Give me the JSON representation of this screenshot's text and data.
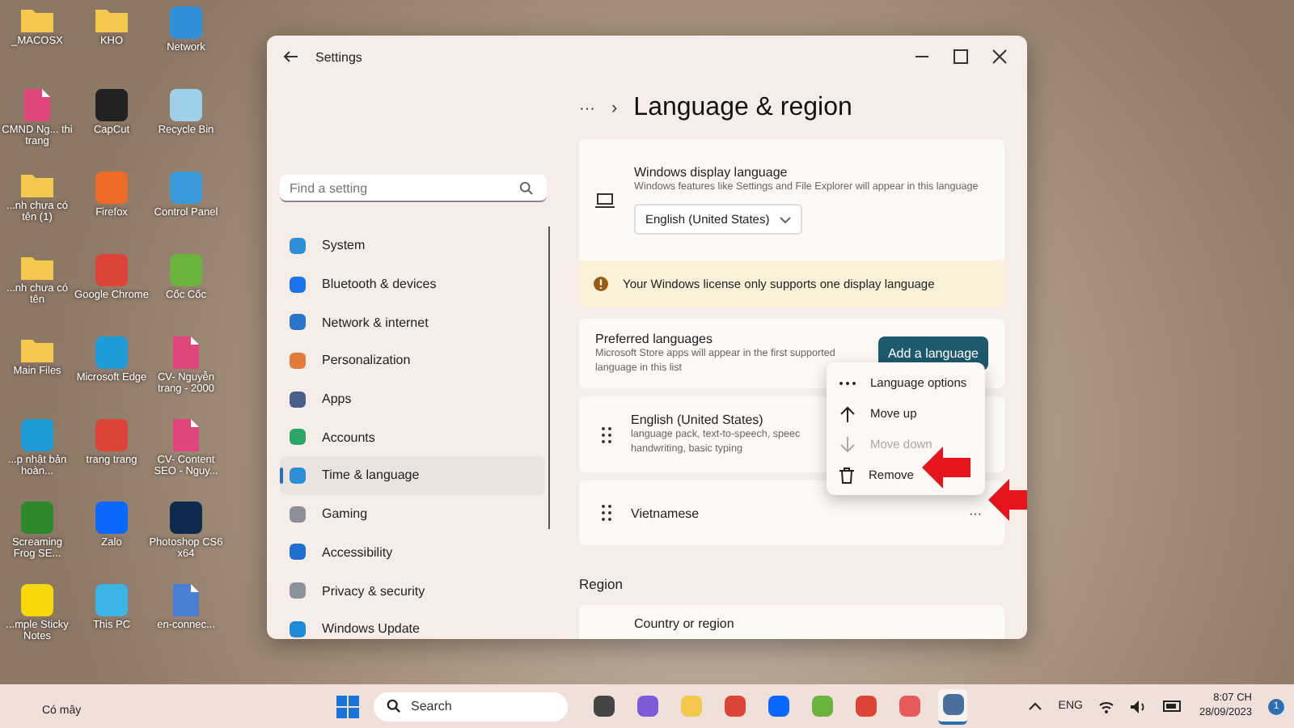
{
  "desktop_icons": [
    {
      "label": "_MACOSX",
      "kind": "folder",
      "color": "#f2c94c"
    },
    {
      "label": "KHO",
      "kind": "folder",
      "color": "#f2c94c"
    },
    {
      "label": "Network",
      "kind": "app",
      "color": "#2f8fd8"
    },
    {
      "label": "CMND Ng... thi trang",
      "kind": "file",
      "color": "#e0457b"
    },
    {
      "label": "CapCut",
      "kind": "app",
      "color": "#222222"
    },
    {
      "label": "Recycle Bin",
      "kind": "app",
      "color": "#9fd0ea"
    },
    {
      "label": "...nh chưa có tên (1)",
      "kind": "folder",
      "color": "#f2c94c"
    },
    {
      "label": "Firefox",
      "kind": "app",
      "color": "#f06a27"
    },
    {
      "label": "Control Panel",
      "kind": "app",
      "color": "#3a9ad9"
    },
    {
      "label": "...nh chưa có tên",
      "kind": "folder",
      "color": "#f2c94c"
    },
    {
      "label": "Google Chrome",
      "kind": "app",
      "color": "#db4437"
    },
    {
      "label": "Cốc Cốc",
      "kind": "app",
      "color": "#6bb33f"
    },
    {
      "label": "Main Files",
      "kind": "folder",
      "color": "#f2c94c"
    },
    {
      "label": "Microsoft Edge",
      "kind": "app",
      "color": "#1f9bd7"
    },
    {
      "label": "CV- Nguyễn trang - 2000",
      "kind": "file",
      "color": "#e0457b"
    },
    {
      "label": "...p nhật bản hoàn...",
      "kind": "app",
      "color": "#1f9bd7"
    },
    {
      "label": "trang trang",
      "kind": "app",
      "color": "#db4437"
    },
    {
      "label": "CV- Content SEO - Nguy...",
      "kind": "file",
      "color": "#e0457b"
    },
    {
      "label": "Screaming Frog SE...",
      "kind": "app",
      "color": "#2c8a2c"
    },
    {
      "label": "Zalo",
      "kind": "app",
      "color": "#0a68ff"
    },
    {
      "label": "Photoshop CS6 x64",
      "kind": "app",
      "color": "#0e2a4e"
    },
    {
      "label": "...mple Sticky Notes",
      "kind": "app",
      "color": "#f5d90a"
    },
    {
      "label": "This PC",
      "kind": "app",
      "color": "#3cb4e6"
    },
    {
      "label": "en-connec...",
      "kind": "file",
      "color": "#4a7fd6"
    }
  ],
  "window": {
    "title": "Settings",
    "search": {
      "placeholder": "Find a setting"
    },
    "sidebar": {
      "items": [
        {
          "label": "System",
          "color": "#2d8fd6",
          "selected": false
        },
        {
          "label": "Bluetooth & devices",
          "color": "#1a73e8",
          "selected": false
        },
        {
          "label": "Network & internet",
          "color": "#2b74c9",
          "selected": false
        },
        {
          "label": "Personalization",
          "color": "#e07b39",
          "selected": false
        },
        {
          "label": "Apps",
          "color": "#4a5f8a",
          "selected": false
        },
        {
          "label": "Accounts",
          "color": "#2ea66a",
          "selected": false
        },
        {
          "label": "Time & language",
          "color": "#2d8fd6",
          "selected": true
        },
        {
          "label": "Gaming",
          "color": "#8a8f99",
          "selected": false
        },
        {
          "label": "Accessibility",
          "color": "#1f6fd1",
          "selected": false
        },
        {
          "label": "Privacy & security",
          "color": "#8c929c",
          "selected": false
        },
        {
          "label": "Windows Update",
          "color": "#1f8ad6",
          "selected": false
        }
      ]
    },
    "breadcrumb": {
      "more": "···",
      "separator": "›",
      "title": "Language & region"
    },
    "display_language": {
      "title": "Windows display language",
      "description": "Windows features like Settings and File Explorer will appear in this language",
      "value": "English (United States)"
    },
    "warning": "Your Windows license only supports one display language",
    "preferred": {
      "title": "Preferred languages",
      "description": "Microsoft Store apps will appear in the first supported language in this list",
      "button": "Add a language"
    },
    "languages": [
      {
        "name": "English (United States)",
        "description": [
          "language pack, text-to-speech, speec",
          "handwriting, basic typing"
        ]
      },
      {
        "name": "Vietnamese",
        "more": "···"
      }
    ],
    "menu": [
      {
        "label": "Language options",
        "kind": "options",
        "disabled": false
      },
      {
        "label": "Move up",
        "kind": "up",
        "disabled": false
      },
      {
        "label": "Move down",
        "kind": "down",
        "disabled": true
      },
      {
        "label": "Remove",
        "kind": "remove",
        "disabled": false
      }
    ],
    "region": {
      "heading": "Region",
      "country": "Country or region"
    }
  },
  "taskbar": {
    "search": "Search",
    "language": "ENG",
    "time": "8:07 CH",
    "date": "28/09/2023",
    "notifications": "1",
    "weather": "Có mây",
    "apps": [
      {
        "color": "#444444",
        "selected": false
      },
      {
        "color": "#7b5cd6",
        "selected": false
      },
      {
        "color": "#f2c94c",
        "selected": false
      },
      {
        "color": "#db4437",
        "selected": false
      },
      {
        "color": "#0a68ff",
        "selected": false
      },
      {
        "color": "#6bb33f",
        "selected": false
      },
      {
        "color": "#db4437",
        "selected": false
      },
      {
        "color": "#e85a5a",
        "selected": false
      },
      {
        "color": "#4a6f9a",
        "selected": true
      }
    ]
  }
}
